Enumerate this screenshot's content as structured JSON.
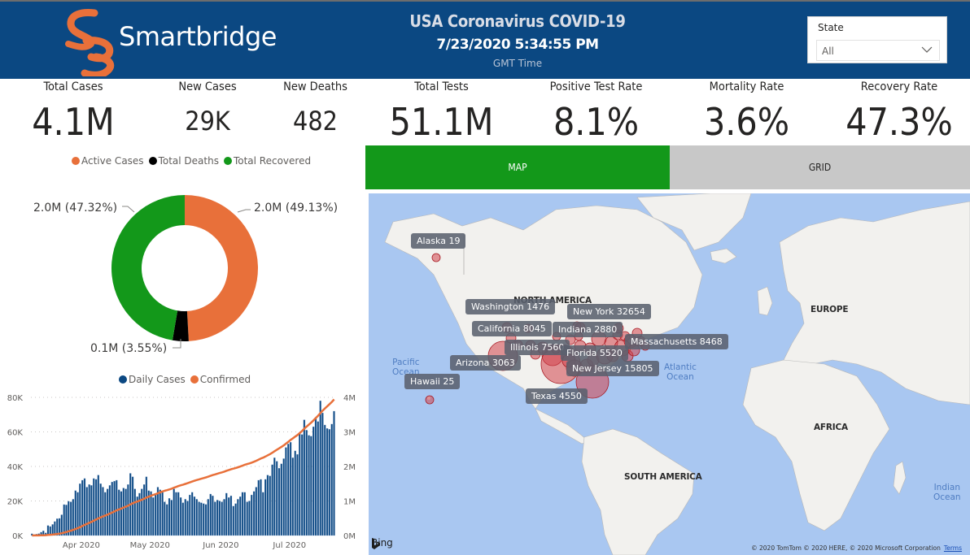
{
  "header": {
    "brand": "Smartbridge",
    "title": "USA Coronavirus COVID-19",
    "datetime": "7/23/2020 5:34:55 PM",
    "timezone": "GMT Time",
    "colors": {
      "header_bg": "#0b4882",
      "logo_orange": "#e8703a"
    }
  },
  "slicer": {
    "label": "State",
    "value": "All",
    "icon": "chevron-down-icon"
  },
  "kpis": [
    {
      "label": "Total Cases",
      "value": "4.1M"
    },
    {
      "label": "New Cases",
      "value": "29K"
    },
    {
      "label": "New Deaths",
      "value": "482"
    },
    {
      "label": "Total Tests",
      "value": "51.1M"
    },
    {
      "label": "Positive Test Rate",
      "value": "8.1%"
    },
    {
      "label": "Mortality Rate",
      "value": "3.6%"
    },
    {
      "label": "Recovery Rate",
      "value": "47.3%"
    }
  ],
  "tabs": [
    {
      "label": "MAP",
      "active": true,
      "color": "#13981a"
    },
    {
      "label": "GRID",
      "active": false,
      "color": "#c8c8c8"
    }
  ],
  "map": {
    "provider": "Bing",
    "copyright": "© 2020 TomTom © 2020 HERE, © 2020 Microsoft Corporation",
    "terms_label": "Terms",
    "regions": [
      "NORTH AMERICA",
      "EUROPE",
      "AFRICA",
      "SOUTH AMERICA"
    ],
    "oceans": [
      {
        "name": "Pacific\nOcean"
      },
      {
        "name": "Atlantic\nOcean"
      },
      {
        "name": "Indian\nOcean"
      }
    ],
    "tooltips": [
      {
        "state": "Alaska",
        "value": 19,
        "text": "Alaska 19"
      },
      {
        "state": "Washington",
        "value": 1476,
        "text": "Washington 1476"
      },
      {
        "state": "New York",
        "value": 32654,
        "text": "New York 32654"
      },
      {
        "state": "California",
        "value": 8045,
        "text": "California 8045"
      },
      {
        "state": "Indiana",
        "value": 2880,
        "text": "Indiana 2880"
      },
      {
        "state": "Massachusetts",
        "value": 8468,
        "text": "Massachusetts 8468"
      },
      {
        "state": "Illinois",
        "value": 7560,
        "text": "Illinois 7560"
      },
      {
        "state": "Florida",
        "value": 5520,
        "text": "Florida 5520"
      },
      {
        "state": "Arizona",
        "value": 3063,
        "text": "Arizona 3063"
      },
      {
        "state": "New Jersey",
        "value": 15805,
        "text": "New Jersey 15805"
      },
      {
        "state": "Hawaii",
        "value": 25,
        "text": "Hawaii 25"
      },
      {
        "state": "Texas",
        "value": 4550,
        "text": "Texas 4550"
      }
    ],
    "bubble_color": "#d2414a"
  },
  "chart_data": [
    {
      "type": "pie",
      "variant": "donut",
      "legend": [
        "Active Cases",
        "Total Deaths",
        "Total Recovered"
      ],
      "legend_position": "top",
      "slices": [
        {
          "name": "Active Cases",
          "value_label": "2.0M",
          "percent": 49.13,
          "color": "#e8703a",
          "label": "2.0M (49.13%)"
        },
        {
          "name": "Total Deaths",
          "value_label": "0.1M",
          "percent": 3.55,
          "color": "#000000",
          "label": "0.1M (3.55%)"
        },
        {
          "name": "Total Recovered",
          "value_label": "2.0M",
          "percent": 47.32,
          "color": "#13981a",
          "label": "2.0M (47.32%)"
        }
      ]
    },
    {
      "type": "bar",
      "combo": "bar+line",
      "legend": [
        "Daily Cases",
        "Confirmed"
      ],
      "legend_position": "top",
      "x_start": "2020-03-10",
      "x_ticks": [
        "Apr 2020",
        "May 2020",
        "Jun 2020",
        "Jul 2020"
      ],
      "y_left": {
        "ticks": [
          "0K",
          "20K",
          "40K",
          "60K",
          "80K"
        ],
        "range": [
          0,
          80000
        ]
      },
      "y_right": {
        "ticks": [
          "0M",
          "1M",
          "2M",
          "3M",
          "4M"
        ],
        "range": [
          0,
          4000000
        ]
      },
      "grid": "dotted horizontal",
      "series": [
        {
          "name": "Daily Cases",
          "type": "bar",
          "axis": "left",
          "color": "#0b4882",
          "values": [
            1000,
            500,
            800,
            1100,
            1900,
            2700,
            1500,
            5800,
            5200,
            6400,
            8100,
            9700,
            9900,
            12000,
            17900,
            17700,
            19800,
            19500,
            21000,
            26000,
            25000,
            30000,
            32000,
            33000,
            28000,
            29500,
            29000,
            33000,
            32500,
            35000,
            30000,
            28000,
            25000,
            27000,
            29000,
            31000,
            31500,
            32000,
            26500,
            25500,
            27500,
            27000,
            29500,
            36000,
            34000,
            27000,
            22500,
            24500,
            27000,
            29500,
            34000,
            26000,
            25500,
            22000,
            23500,
            28000,
            26500,
            25000,
            19500,
            18000,
            21500,
            20500,
            27000,
            25000,
            25000,
            22000,
            19000,
            21000,
            20000,
            23500,
            25000,
            22500,
            21000,
            19500,
            19000,
            18500,
            18000,
            21000,
            24000,
            23000,
            19500,
            20500,
            20000,
            19500,
            21000,
            24500,
            22000,
            23000,
            17000,
            18500,
            21000,
            22500,
            25000,
            25000,
            19500,
            20000,
            23500,
            25500,
            28000,
            32000,
            32500,
            25000,
            32500,
            35000,
            34500,
            41000,
            45000,
            43000,
            39000,
            41500,
            44500,
            51000,
            53000,
            54000,
            45000,
            49000,
            47000,
            59000,
            58500,
            67000,
            61000,
            58000,
            57500,
            63000,
            68000,
            66000,
            78000,
            71000,
            64000,
            62000,
            61500,
            64500,
            72000
          ]
        },
        {
          "name": "Confirmed",
          "type": "line",
          "axis": "right",
          "color": "#e8703a",
          "note": "cumulative of daily cases, ending ~4.0M"
        }
      ]
    }
  ]
}
